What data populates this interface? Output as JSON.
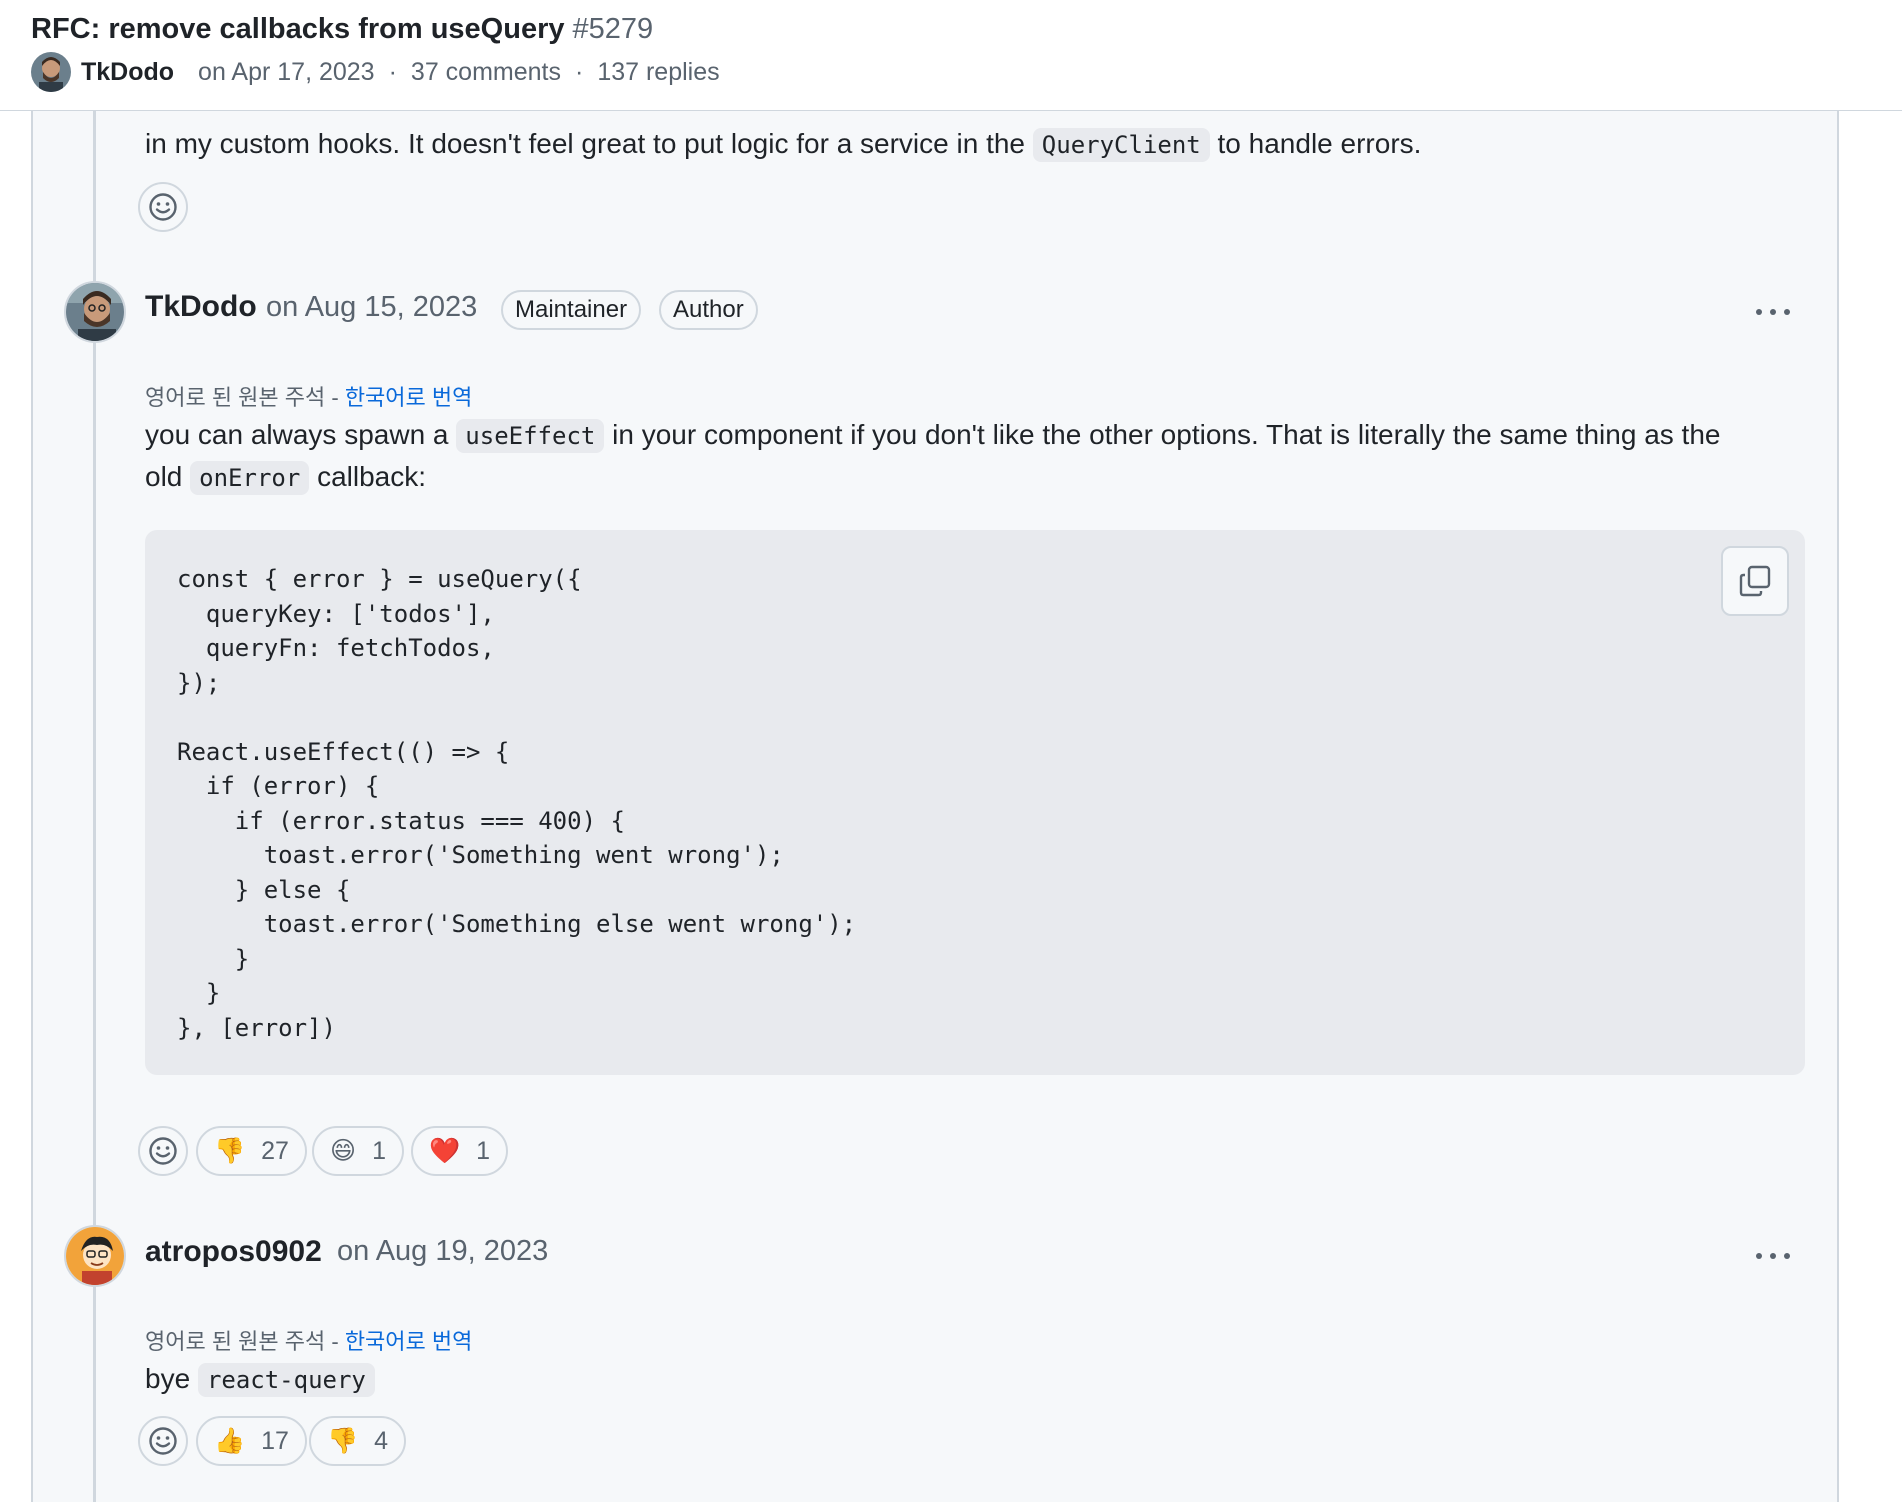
{
  "header": {
    "title": "RFC: remove callbacks from useQuery",
    "number": "#5279",
    "author": "TkDodo",
    "date": "on Apr 17, 2023",
    "comments": "37 comments",
    "separator": "·",
    "replies": "137 replies"
  },
  "prev_comment": {
    "text_before": "in my custom hooks. It doesn't feel great to put logic for a service in the",
    "code": "QueryClient",
    "text_after": "to handle errors."
  },
  "comment1": {
    "author": "TkDodo",
    "date": "on Aug 15, 2023",
    "badges": [
      "Maintainer",
      "Author"
    ],
    "translate_prefix": "영어로 된 원본 주석 - ",
    "translate_link": "한국어로 번역",
    "line1_before": "you can always spawn a",
    "line1_code": "useEffect",
    "line1_after": "in your component if you don't like the other options. That is literally the same thing as the",
    "line2_before": "old",
    "line2_code": "onError",
    "line2_after": "callback:",
    "code": "const { error } = useQuery({\n  queryKey: ['todos'],\n  queryFn: fetchTodos,\n});\n\nReact.useEffect(() => {\n  if (error) {\n    if (error.status === 400) {\n      toast.error('Something went wrong');\n    } else {\n      toast.error('Something else went wrong');\n    }\n  }\n}, [error])",
    "reactions": [
      {
        "emoji": "👎",
        "count": "27"
      },
      {
        "emoji": "😄",
        "count": "1"
      },
      {
        "emoji": "❤️",
        "count": "1"
      }
    ]
  },
  "comment2": {
    "author": "atropos0902",
    "date": "on Aug 19, 2023",
    "translate_prefix": "영어로 된 원본 주석 - ",
    "translate_link": "한국어로 번역",
    "text": "bye",
    "code": "react-query",
    "reactions": [
      {
        "emoji": "👍",
        "count": "17"
      },
      {
        "emoji": "👎",
        "count": "4"
      }
    ]
  }
}
